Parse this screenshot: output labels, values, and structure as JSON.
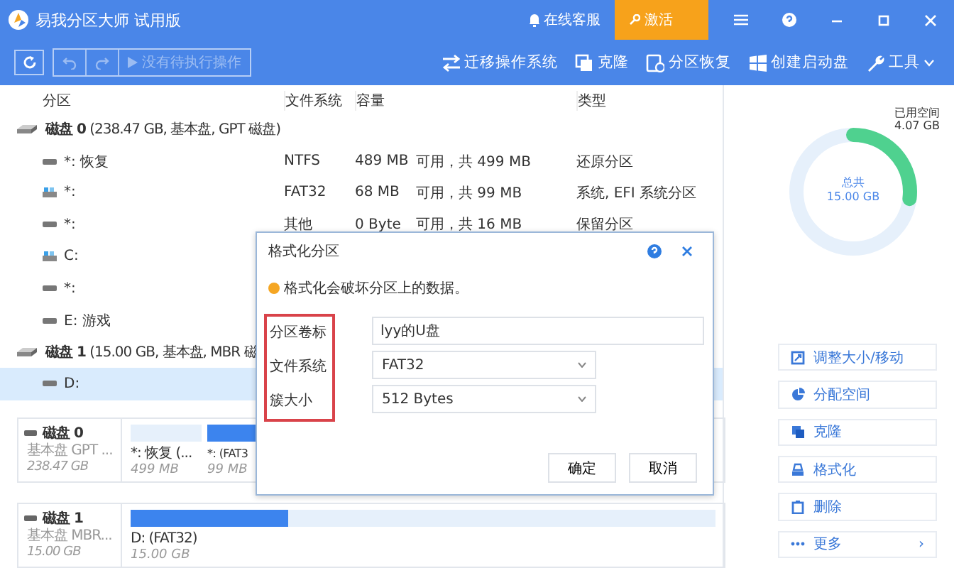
{
  "window": {
    "title": "易我分区大师 试用版",
    "support": "在线客服",
    "activate": "激活"
  },
  "toolbar": {
    "pending": "没有待执行操作",
    "undo_disabled": true,
    "tools": [
      {
        "kind": "migrate",
        "label": "迁移操作系统"
      },
      {
        "kind": "clone",
        "label": "克隆"
      },
      {
        "kind": "recover",
        "label": "分区恢复"
      },
      {
        "kind": "bootdisk",
        "label": "创建启动盘"
      },
      {
        "kind": "tools",
        "label": "工具"
      }
    ]
  },
  "table": {
    "columns": [
      "分区",
      "文件系统",
      "容量",
      "类型"
    ],
    "rows": [
      {
        "kind": "disk",
        "name": "磁盘 0",
        "detail": "(238.47 GB, 基本盘, GPT 磁盘)",
        "selected": false
      },
      {
        "kind": "partition",
        "system": false,
        "name": "*: 恢复",
        "cells": [
          "NTFS",
          "489 MB",
          "可用，共 499 MB",
          "还原分区"
        ],
        "selected": false
      },
      {
        "kind": "partition",
        "system": true,
        "name": "*:",
        "cells": [
          "FAT32",
          "68 MB",
          "可用，共 99 MB",
          "系统, EFI 系统分区"
        ],
        "selected": false
      },
      {
        "kind": "partition",
        "system": false,
        "name": "*:",
        "cells": [
          "其他",
          "0 Byte",
          "可用，共 16 MB",
          "保留分区"
        ],
        "selected": false
      },
      {
        "kind": "partition",
        "system": true,
        "name": "C:",
        "selected": false
      },
      {
        "kind": "partition",
        "system": false,
        "name": "*:",
        "selected": false
      },
      {
        "kind": "partition",
        "system": false,
        "name": "E: 游戏",
        "selected": false
      },
      {
        "kind": "disk",
        "name": "磁盘 1",
        "detail": "(15.00 GB, 基本盘, MBR 磁",
        "selected": false
      },
      {
        "kind": "partition",
        "system": false,
        "name": "D:",
        "selected": true
      }
    ]
  },
  "disk_map": [
    {
      "name": "磁盘 0",
      "type": "基本盘 GPT ...",
      "size": "238.47 GB",
      "partitions": [
        {
          "label": "*: 恢复 (...",
          "size": "499 MB",
          "level": 0
        },
        {
          "label": "*: (FAT3",
          "size": "99 MB",
          "level": 1
        }
      ]
    },
    {
      "name": "磁盘 1",
      "type": "基本盘 MBR...",
      "size": "15.00 GB",
      "partitions": [
        {
          "label": "D: (FAT32)",
          "size": "15.00 GB",
          "level": 0.27
        }
      ]
    }
  ],
  "usage": {
    "used_label": "已用空间",
    "used": "4.07 GB",
    "total_label": "总共",
    "total": "15.00 GB",
    "level": 0.27
  },
  "actions": [
    {
      "kind": "resize",
      "label": "调整大小/移动"
    },
    {
      "kind": "allocate",
      "label": "分配空间"
    },
    {
      "kind": "clone",
      "label": "克隆"
    },
    {
      "kind": "format",
      "label": "格式化"
    },
    {
      "kind": "delete",
      "label": "删除"
    },
    {
      "kind": "more",
      "label": "更多",
      "arrow": "›"
    }
  ],
  "dialog": {
    "title": "格式化分区",
    "warning": "格式化会破坏分区上的数据。",
    "fields": [
      {
        "kind": "input",
        "label": "分区卷标",
        "value": "lyy的U盘"
      },
      {
        "kind": "select",
        "label": "文件系统",
        "value": "FAT32"
      },
      {
        "kind": "select",
        "label": "簇大小",
        "value": "512 Bytes"
      }
    ],
    "buttons": [
      "确定",
      "取消"
    ]
  }
}
